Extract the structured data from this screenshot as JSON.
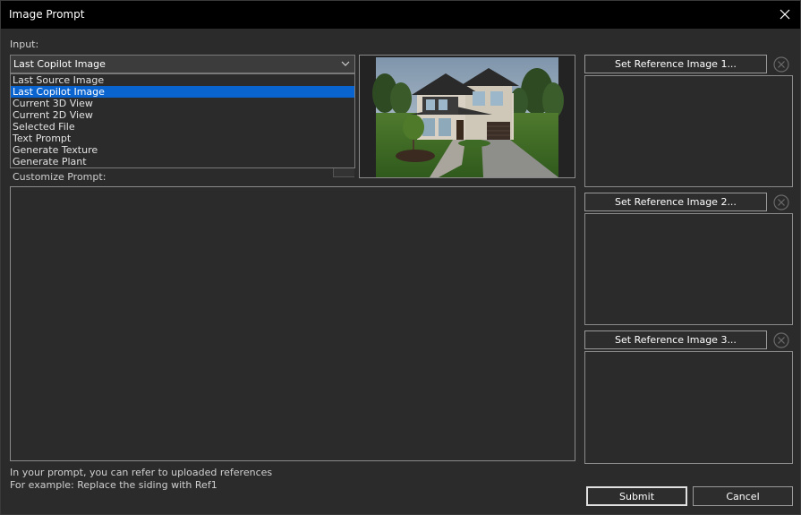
{
  "window": {
    "title": "Image Prompt",
    "close_icon": "close-icon"
  },
  "input": {
    "label": "Input:",
    "selected_value": "Last Copilot Image",
    "options": [
      "Last Source Image",
      "Last Copilot Image",
      "Current 3D View",
      "Current 2D View",
      "Selected File",
      "Text Prompt",
      "Generate Texture",
      "Generate Plant"
    ],
    "highlighted_index": 1
  },
  "preview": {
    "description_icon": "house-rendering-image"
  },
  "prompt": {
    "label": "Customize Prompt:",
    "value": ""
  },
  "references": [
    {
      "button_label": "Set Reference Image 1..."
    },
    {
      "button_label": "Set Reference Image 2..."
    },
    {
      "button_label": "Set Reference Image 3..."
    }
  ],
  "hints": {
    "line1": "In your prompt, you can refer to uploaded references",
    "line2": "For example: Replace the siding with Ref1"
  },
  "buttons": {
    "submit": "Submit",
    "cancel": "Cancel"
  },
  "colors": {
    "background": "#2b2b2b",
    "titlebar": "#000000",
    "selection": "#0a64d0",
    "border": "#8a8a8a"
  }
}
